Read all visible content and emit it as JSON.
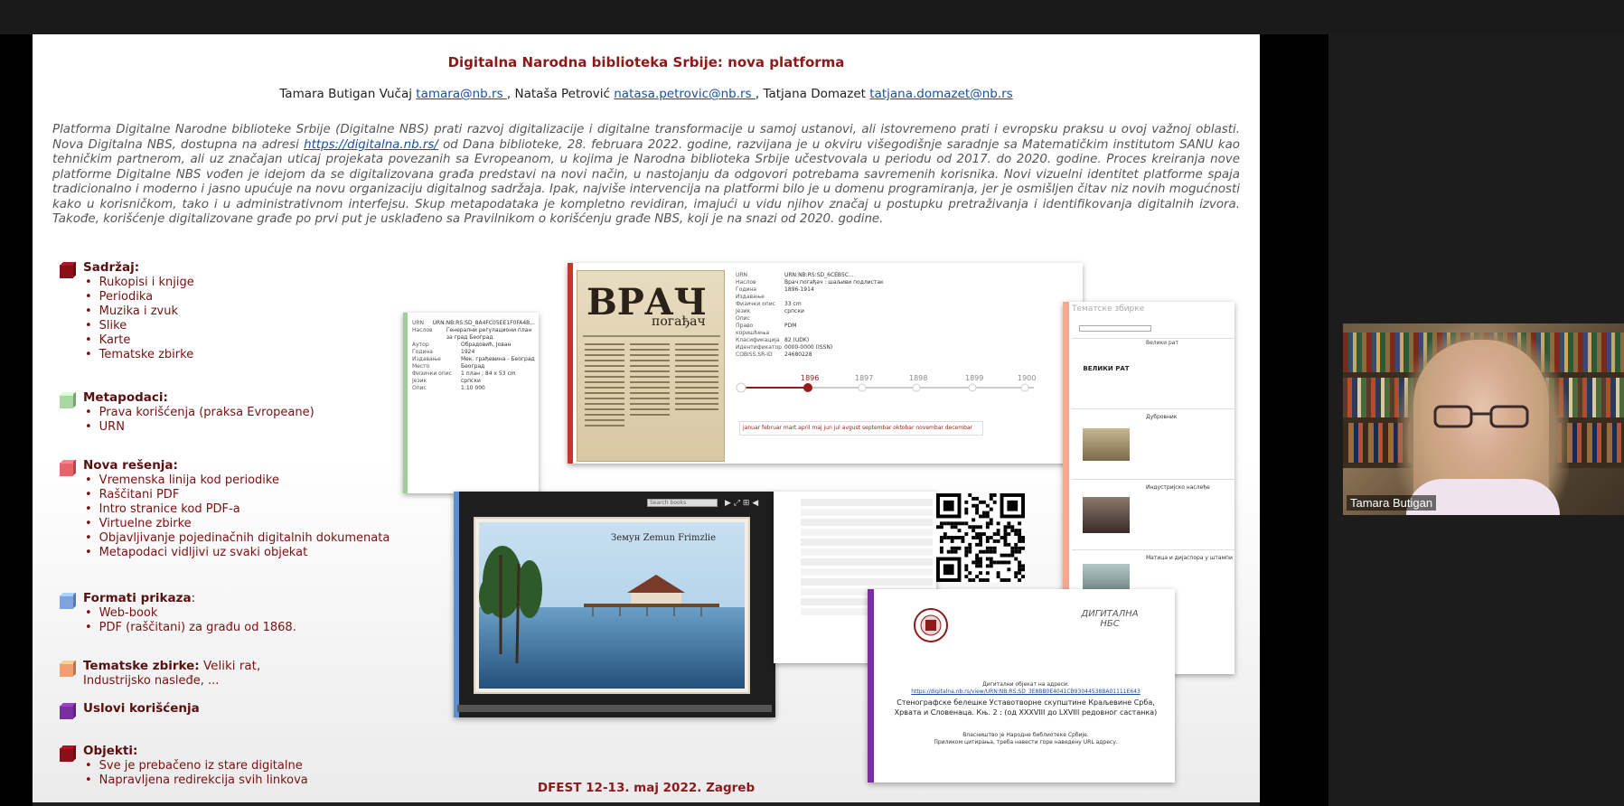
{
  "slide": {
    "title": "Digitalna Narodna biblioteka Srbije: nova platforma",
    "authors": {
      "a1": "Tamara Butigan Vučaj ",
      "e1": "tamara@nb.rs ",
      "a2": ", Nataša Petrović ",
      "e2": "natasa.petrovic@nb.rs ",
      "a3": ", Tatjana Domazet ",
      "e3": "tatjana.domazet@nb.rs"
    },
    "abstract": {
      "p1": "Platforma Digitalne Narodne biblioteke Srbije (Digitalne NBS) prati razvoj digitalizacije i digitalne transformacije u samoj ustanovi, ali istovremeno prati i evropsku praksu u ovoj važnoj oblasti. Nova Digitalna NBS, dostupna na adresi ",
      "link": "https://digitalna.nb.rs/",
      "p2": " od Dana biblioteke, 28. februara 2022. godine, razvijana je u okviru višegodišnje saradnje sa Matematičkim institutom SANU kao tehničkim partnerom, ali uz značajan uticaj projekata povezanih sa Evropeanom, u kojima je Narodna biblioteka Srbije učestvovala u periodu od 2017. do 2020. godine. Proces kreiranja nove platforme Digitalne NBS vođen je idejom da se digitalizovana građa predstavi na novi način, u nastojanju da odgovori potrebama savremenih korisnika. Novi vizuelni identitet platforme spaja tradicionalno i moderno i jasno upućuje na novu organizaciju digitalnog sadržaja. Ipak, najviše intervencija na platformi bilo je u domenu programiranja, jer je osmišljen čitav niz novih mogućnosti kako u korisničkom, tako i u administrativnom interfejsu. Skup metapodataka je kompletno revidiran, imajući u vidu njihov značaj u postupku pretraživanja i identifikovanja digitalnih izvora. Takođe, korišćenje digitalizovane građe po prvi put je usklađeno sa Pravilnikom o korišćenju građe NBS, koji je na snazi od 2020. godine."
    },
    "sections": [
      {
        "title": "Sadržaj:",
        "color": "#8b0f1a",
        "items": [
          "Rukopisi i knjige",
          "Periodika",
          "Muzika i zvuk",
          "Slike",
          "Karte",
          "Tematske zbirke"
        ]
      },
      {
        "title": "Metapodaci:",
        "color": "#a8d8a0",
        "items": [
          "Prava korišćenja (praksa Evropeane)",
          "URN"
        ]
      },
      {
        "title": "Nova rešenja:",
        "color": "#e8636b",
        "items": [
          "Vremenska linija kod periodike",
          "Raščitani PDF",
          "Intro stranice kod PDF-a",
          "Virtuelne zbirke",
          "Objavljivanje pojedinačnih digitalnih dokumenata",
          "Metapodaci vidljivi uz svaki objekat"
        ]
      },
      {
        "title": "Formati prikaza",
        "title_plain": ":",
        "color": "#7fa3e0",
        "items": [
          "Web-book",
          "PDF (raščitani) za građu od 1868."
        ]
      },
      {
        "title": "Tematske zbirke:",
        "title_plain": " Veliki rat,",
        "sub": "Industrijsko nasleđe, ...",
        "color": "#f0a070",
        "items": []
      },
      {
        "title": "Uslovi korišćenja",
        "color": "#7a2fa0",
        "items": []
      },
      {
        "title": "Objekti:",
        "color": "#8b0f1a",
        "items": [
          "Sve je prebačeno iz stare digitalne",
          "Napravljena redirekcija svih linkova"
        ]
      }
    ],
    "footer": "DFEST 12-13. maj 2022. Zagreb",
    "screens": {
      "timeline_years": [
        "1896",
        "1897",
        "1898",
        "1899",
        "1900"
      ],
      "months": "januar februar mart april maj jun jul avgust septembar oktobar novembar decembar",
      "postcard_caption": "Земун Zemun Frimzlie",
      "pdf_title": "Стенографске белешке Уставотворне скупштине Краљевине Срба, Хрвата и Словенаца. Књ. 2 : (од XXXVIII до LXVIII редовног састанка)",
      "pdf_intro": "Дигитални објекат на адреси:",
      "pdf_url": "https://digitalna.nb.rs/view/URN:NB:RS:SD_3E8BB0E4041CB93044538BA01111E643",
      "pdf_note1": "Власништво је Народне библиотеке Србије.",
      "pdf_note2": "Приликом цитирања, треба навести горе наведену URL адресу.",
      "digitalna_logo": "ДИГИТАЛНА НБС",
      "thematic_title": "Тематске збирке",
      "thematic_items": [
        "Велики рат",
        "Дубровник",
        "Индустријско наслеђе",
        "Матица и дијаспора у штампи"
      ],
      "veliki_rat_logo": "ВЕЛИКИ РАТ",
      "search_box": "Search books",
      "left_meta_keys": [
        "URN",
        "Наслов",
        "Аутор",
        "Година",
        "Издавање",
        "Место",
        "Физички опис",
        "Језик",
        "Опис"
      ],
      "left_meta_vals": [
        "URN:NB:RS:SD_8A4FC05EE1F0FA4B...",
        "Генерални регулациони план за град Београд",
        "Обрадовић, Јован",
        "1924",
        "Мек. грађевина - Београд",
        "Београд",
        "1 план ; 84 x 53 cm",
        "српски",
        "1:10 000"
      ],
      "main_meta_keys": [
        "URN",
        "Наслов",
        "Година",
        "Издавање",
        "Физички опис",
        "Језик",
        "Опис",
        "Право коришћења",
        "Класификација",
        "Идентификатор",
        "COBISS.SR-ID"
      ],
      "main_meta_vals": [
        "URN:NB:RS:SD_6CEB5C...",
        "Врач погађач : шаљиви подлистак",
        "1896-1914",
        "",
        "33 cm",
        "српски",
        "",
        "PDM",
        "82 (UDK)",
        "0000-0000 (ISSN)",
        "24680228"
      ]
    }
  },
  "webcam": {
    "name": "Tamara Butigan"
  }
}
